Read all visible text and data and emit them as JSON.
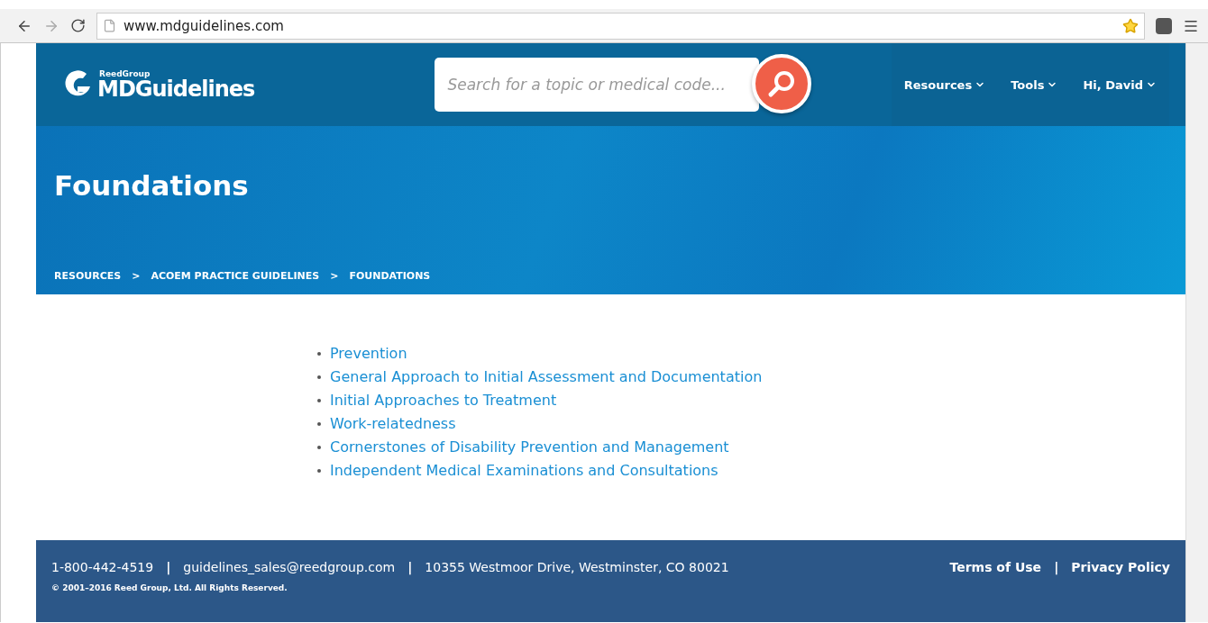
{
  "browser": {
    "url": "www.mdguidelines.com",
    "bookmarked": true
  },
  "header": {
    "logo_small": "ReedGroup",
    "logo": "MDGuidelines",
    "search": {
      "placeholder": "Search for a topic or medical code..."
    },
    "nav": [
      {
        "label": "Resources"
      },
      {
        "label": "Tools"
      },
      {
        "label": "Hi, David"
      }
    ]
  },
  "hero": {
    "title": "Foundations",
    "breadcrumb": [
      {
        "label": "RESOURCES"
      },
      {
        "label": ">",
        "kind": "separator"
      },
      {
        "label": "ACOEM PRACTICE GUIDELINES"
      },
      {
        "label": ">",
        "kind": "separator"
      },
      {
        "label": "FOUNDATIONS"
      }
    ]
  },
  "links": [
    "Prevention",
    "General Approach to Initial Assessment and Documentation",
    "Initial Approaches to Treatment",
    "Work-relatedness",
    "Cornerstones of Disability Prevention and Management",
    "Independent Medical Examinations and Consultations"
  ],
  "footer": {
    "contact": [
      {
        "label": "1-800-442-4519"
      },
      {
        "label": "|",
        "kind": "separator"
      },
      {
        "label": "guidelines_sales@reedgroup.com"
      },
      {
        "label": "|",
        "kind": "separator"
      },
      {
        "label": "10355 Westmoor Drive, Westminster, CO 80021"
      }
    ],
    "copyright": "© 2001–2016 Reed Group, Ltd. All Rights Reserved.",
    "links": [
      {
        "label": "Terms of Use"
      },
      {
        "label": "|",
        "kind": "separator"
      },
      {
        "label": "Privacy Policy"
      }
    ]
  }
}
